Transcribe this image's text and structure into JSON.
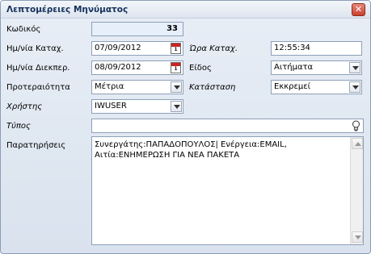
{
  "window": {
    "title": "Λεπτομέρειες Μηνύματος"
  },
  "fields": {
    "code": {
      "label": "Κωδικός",
      "value": "33"
    },
    "entry_date": {
      "label": "Ημ/νία Καταχ.",
      "value": "07/09/2012"
    },
    "entry_time": {
      "label": "Ώρα Καταχ.",
      "value": "12:55:34"
    },
    "handling_date": {
      "label": "Ημ/νία Διεκπερ.",
      "value": "08/09/2012"
    },
    "type_kind": {
      "label": "Είδος",
      "value": "Αιτήματα"
    },
    "priority": {
      "label": "Προτεραιότητα",
      "value": "Μέτρια"
    },
    "status": {
      "label": "Κατάσταση",
      "value": "Εκκρεμεί"
    },
    "user": {
      "label": "Χρήστης",
      "value": "IWUSER"
    },
    "typos": {
      "label": "Τύπος",
      "value": ""
    },
    "remarks": {
      "label": "Παρατηρήσεις",
      "value": "Συνεργάτης:ΠΑΠΑΔΟΠΟΥΛΟΣ| Ενέργεια:EMAIL,\nΑιτία:ΕΝΗΜΕΡΩΣΗ ΓΙΑ ΝΕΑ ΠΑΚΕΤΑ"
    }
  },
  "calendar_icon_text": {
    "top": "JAN",
    "day": "1"
  },
  "close_glyph": "✕"
}
